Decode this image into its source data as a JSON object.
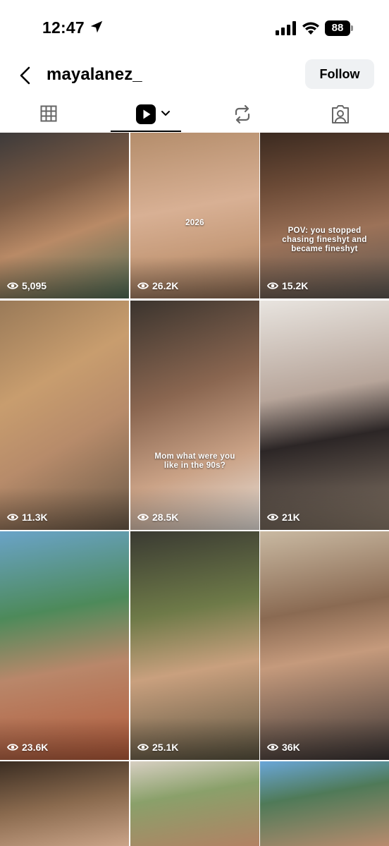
{
  "status": {
    "time": "12:47",
    "battery": "88"
  },
  "header": {
    "username": "mayalanez_",
    "follow_label": "Follow"
  },
  "tabs": [
    {
      "name": "grid",
      "icon": "grid-icon"
    },
    {
      "name": "reels",
      "icon": "reels-icon",
      "active": true
    },
    {
      "name": "reposts",
      "icon": "repost-icon"
    },
    {
      "name": "tagged",
      "icon": "tagged-icon"
    }
  ],
  "posts": [
    {
      "views": "5,095",
      "caption": ""
    },
    {
      "views": "26.2K",
      "caption": "2026"
    },
    {
      "views": "15.2K",
      "caption": "POV: you stopped chasing fineshyt and became fineshyt"
    },
    {
      "views": "11.3K",
      "caption": ""
    },
    {
      "views": "28.5K",
      "caption": "Mom what were you like in the 90s?"
    },
    {
      "views": "21K",
      "caption": ""
    },
    {
      "views": "23.6K",
      "caption": ""
    },
    {
      "views": "25.1K",
      "caption": ""
    },
    {
      "views": "36K",
      "caption": ""
    },
    {
      "views": "",
      "caption": ""
    },
    {
      "views": "",
      "caption": ""
    },
    {
      "views": "",
      "caption": ""
    }
  ]
}
